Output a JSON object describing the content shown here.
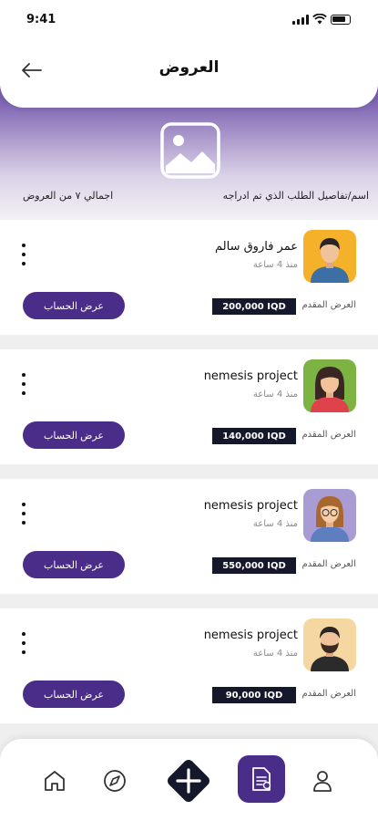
{
  "status_bar": {
    "time": "9:41"
  },
  "header": {
    "title": "العروض"
  },
  "summary": {
    "request_label": "اسم/تفاصيل الطلب الذي تم ادراجه",
    "total_label": "اجمالي ٧ من العروض"
  },
  "offers": [
    {
      "name": "عمر فاروق سالم",
      "time": "منذ 4 ساعة",
      "offer_label": "العرض المقدم",
      "price": "200,000 IQD",
      "button": "عرض الحساب",
      "avatar_bg": "#f6b12a",
      "avatar_kind": "man"
    },
    {
      "name": "nemesis  project",
      "time": "منذ 4 ساعة",
      "offer_label": "العرض المقدم",
      "price": "140,000 IQD",
      "button": "عرض الحساب",
      "avatar_bg": "#7cb342",
      "avatar_kind": "woman"
    },
    {
      "name": "nemesis  project",
      "time": "منذ 4 ساعة",
      "offer_label": "العرض المقدم",
      "price": "550,000 IQD",
      "button": "عرض الحساب",
      "avatar_bg": "#a99bd3",
      "avatar_kind": "woman-glasses"
    },
    {
      "name": "nemesis  project",
      "time": "منذ 4 ساعة",
      "offer_label": "العرض المقدم",
      "price": "90,000 IQD",
      "button": "عرض الحساب",
      "avatar_bg": "#f4d7a1",
      "avatar_kind": "man-beard"
    }
  ],
  "colors": {
    "primary": "#4a2c89",
    "price_bg": "#15182a"
  },
  "nav": {
    "items": [
      "home-icon",
      "compass-icon",
      "add-icon",
      "documents-icon",
      "profile-icon"
    ],
    "active": "documents-icon"
  }
}
